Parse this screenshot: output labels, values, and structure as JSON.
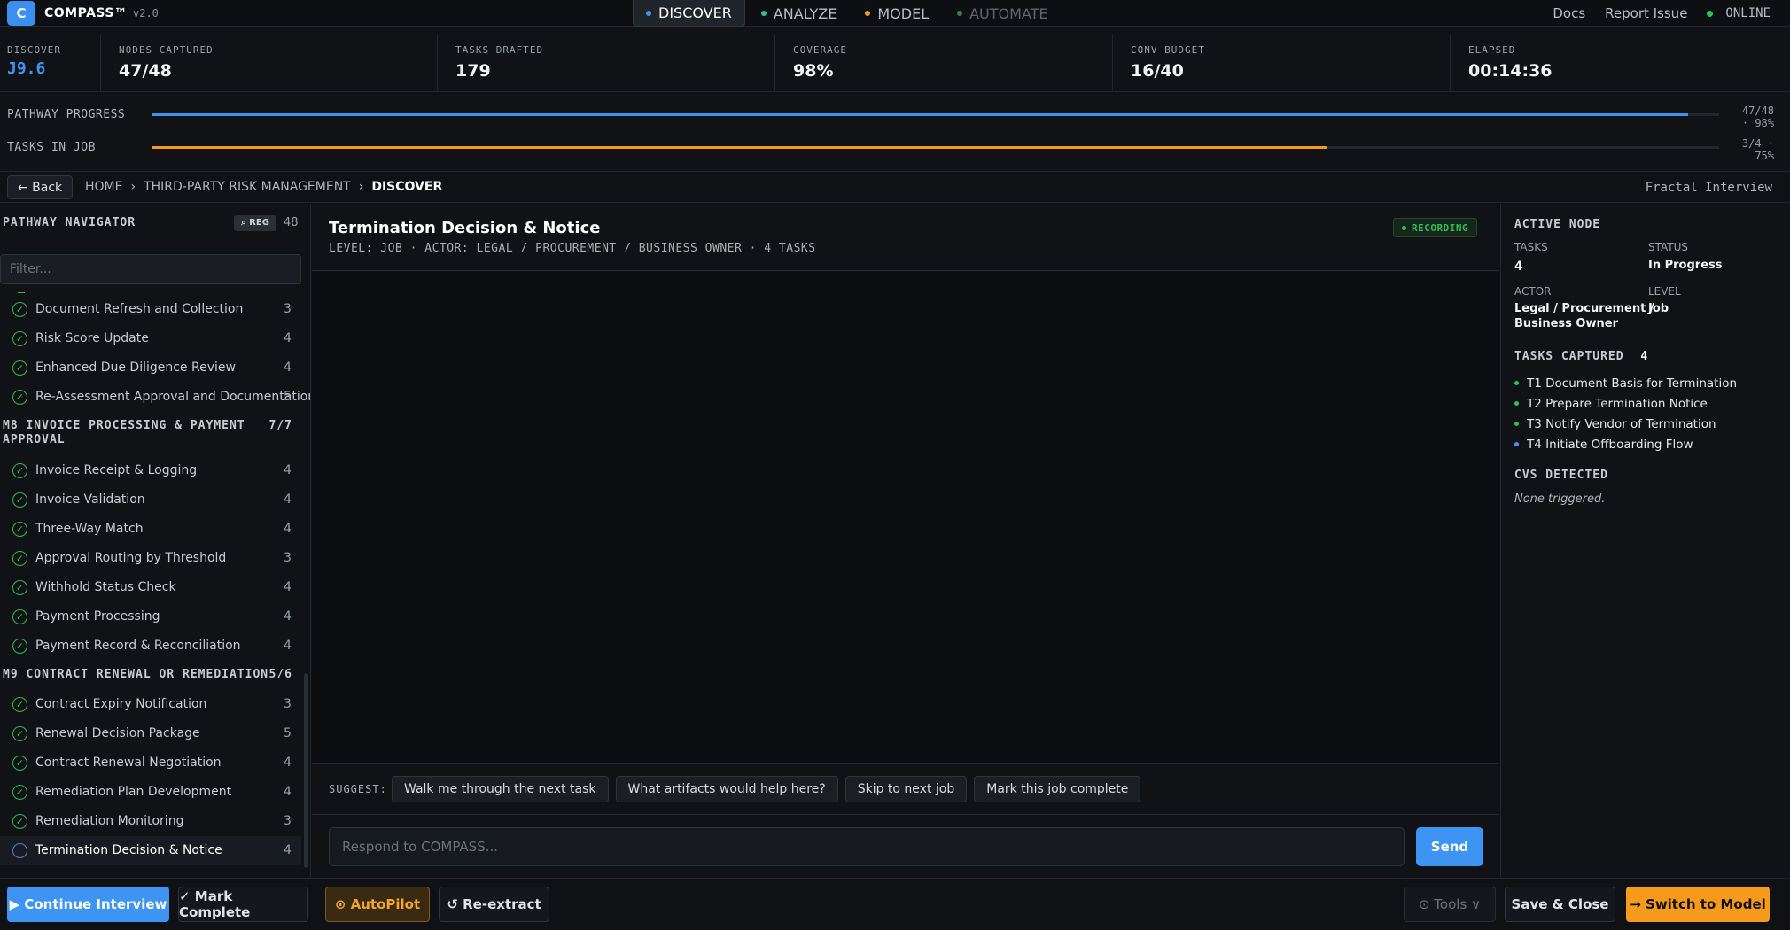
{
  "app": {
    "logo": "C",
    "brand": "COMPASS™",
    "version": "v2.0"
  },
  "nav": {
    "tabs": [
      {
        "label": "DISCOVER",
        "color": "#3d94f2"
      },
      {
        "label": "ANALYZE",
        "color": "#2fbf9f"
      },
      {
        "label": "MODEL",
        "color": "#f59a1b"
      },
      {
        "label": "AUTOMATE",
        "color": "#2f7f55"
      }
    ],
    "docs": "Docs",
    "report": "Report Issue",
    "status": "ONLINE",
    "status_color": "#2fbf55"
  },
  "stats": [
    {
      "label": "DISCOVER",
      "value": "J9.6"
    },
    {
      "label": "NODES CAPTURED",
      "value": "47/48"
    },
    {
      "label": "TASKS DRAFTED",
      "value": "179"
    },
    {
      "label": "COVERAGE",
      "value": "98%"
    },
    {
      "label": "CONV BUDGET",
      "value": "16/40"
    },
    {
      "label": "ELAPSED",
      "value": "00:14:36"
    }
  ],
  "progress": {
    "pathway": {
      "label": "PATHWAY PROGRESS",
      "value_line1": "47/48",
      "value_line2": "· 98%",
      "fraction": 0.98,
      "color": "#3d94f2"
    },
    "tasks": {
      "label": "TASKS IN JOB",
      "value_line1": "3/4 ·",
      "value_line2": "75%",
      "fraction": 0.75,
      "color": "#f59a1b"
    }
  },
  "breadcrumb": {
    "back": "← Back",
    "items": [
      "HOME",
      "THIRD-PARTY RISK MANAGEMENT"
    ],
    "current": "DISCOVER",
    "sep": "›",
    "mode": "Fractal Interview"
  },
  "sidebar": {
    "title": "PATHWAY NAVIGATOR",
    "reg_badge": "⌕ REG",
    "count": "48",
    "filter_placeholder": "Filter...",
    "items_top": [
      {
        "name": "Document Refresh and Collection",
        "count": "3"
      },
      {
        "name": "Risk Score Update",
        "count": "4"
      },
      {
        "name": "Enhanced Due Diligence Review",
        "count": "4"
      },
      {
        "name": "Re-Assessment Approval and Documentation",
        "count": "5"
      }
    ],
    "group_m8": {
      "line1": "M8 INVOICE PROCESSING & PAYMENT",
      "line2": "APPROVAL",
      "progress": "7/7"
    },
    "items_m8": [
      {
        "name": "Invoice Receipt & Logging",
        "count": "4"
      },
      {
        "name": "Invoice Validation",
        "count": "4"
      },
      {
        "name": "Three-Way Match",
        "count": "4"
      },
      {
        "name": "Approval Routing by Threshold",
        "count": "3"
      },
      {
        "name": "Withhold Status Check",
        "count": "4"
      },
      {
        "name": "Payment Processing",
        "count": "4"
      },
      {
        "name": "Payment Record & Reconciliation",
        "count": "4"
      }
    ],
    "group_m9": {
      "line1": "M9 CONTRACT RENEWAL OR REMEDIATION",
      "progress": "5/6"
    },
    "items_m9": [
      {
        "name": "Contract Expiry Notification",
        "count": "3"
      },
      {
        "name": "Renewal Decision Package",
        "count": "5"
      },
      {
        "name": "Contract Renewal Negotiation",
        "count": "4"
      },
      {
        "name": "Remediation Plan Development",
        "count": "4"
      },
      {
        "name": "Remediation Monitoring",
        "count": "3"
      }
    ],
    "active_item": {
      "name": "Termination Decision & Notice",
      "count": "4"
    }
  },
  "main": {
    "title": "Termination Decision & Notice",
    "subtitle": "LEVEL: JOB · ACTOR: LEGAL / PROCUREMENT / BUSINESS OWNER · 4 TASKS",
    "recording": "RECORDING",
    "suggest_label": "SUGGEST:",
    "suggestions": [
      "Walk me through the next task",
      "What artifacts would help here?",
      "Skip to next job",
      "Mark this job complete"
    ],
    "input_placeholder": "Respond to COMPASS...",
    "send": "Send"
  },
  "panel": {
    "title": "ACTIVE NODE",
    "tasks_label": "TASKS",
    "tasks_value": "4",
    "status_label": "STATUS",
    "status_value": "In Progress",
    "actor_label": "ACTOR",
    "actor_line1": "Legal / Procurement /",
    "actor_line2": "Business Owner",
    "level_label": "LEVEL",
    "level_value": "Job",
    "captured_title": "TASKS CAPTURED",
    "captured_count": "4",
    "tasks": [
      {
        "label": "T1 Document Basis for Termination",
        "color": "#2fbf55"
      },
      {
        "label": "T2 Prepare Termination Notice",
        "color": "#2fbf55"
      },
      {
        "label": "T3 Notify Vendor of Termination",
        "color": "#2fbf55"
      },
      {
        "label": "T4 Initiate Offboarding Flow",
        "color": "#3d94f2"
      }
    ],
    "cvs_title": "CVS DETECTED",
    "cvs_none": "None triggered."
  },
  "bottom": {
    "continue": "▶ Continue Interview",
    "complete": "✓ Mark Complete",
    "autopilot": "⊙ AutoPilot",
    "reextract": "↺ Re-extract",
    "tools": "⊙ Tools ∨",
    "save": "Save & Close",
    "switch": "→ Switch to Model"
  }
}
